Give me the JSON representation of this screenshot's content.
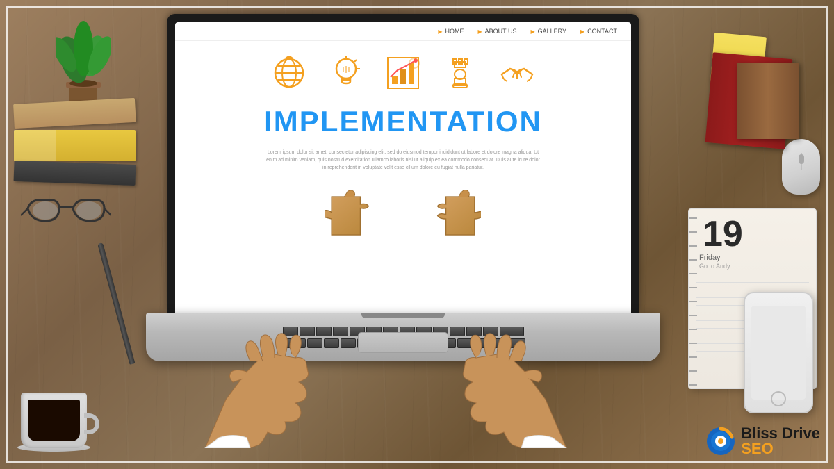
{
  "brand": {
    "name": "Bliss Drive SEO",
    "name_parts": {
      "bliss": "Bliss ",
      "drive": "Drive",
      "seo": "SEO"
    }
  },
  "website": {
    "nav": {
      "items": [
        "HOME",
        "ABOUT US",
        "GALLERY",
        "CONTACT"
      ]
    },
    "title": "IMPLEMENTATION",
    "body_text": "Lorem ipsum dolor sit amet, consectetur adipiscing elit, sed do eiusmod tempor incididunt ut labore et dolore magna aliqua. Ut enim ad minim veniam, quis nostrud exercitation ullamco laboris nisi ut aliquip ex ea commodo consequat. Duis aute irure dolor in reprehenderit in voluptate velit esse cillum dolore eu fugiat nulla pariatur.",
    "icons": [
      "🌐",
      "💡",
      "📊",
      "♟️",
      "🤝"
    ]
  },
  "notebook": {
    "date": "19",
    "day_label": "Friday",
    "sub_label": "Go to Andy..."
  }
}
